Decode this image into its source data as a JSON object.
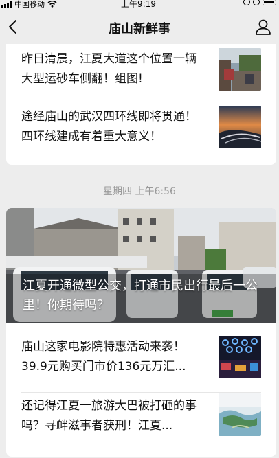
{
  "status_bar": {
    "carrier": "中国移动",
    "time": "上午9:19"
  },
  "nav": {
    "title": "庙山新鲜事"
  },
  "top_articles": [
    {
      "title": "昨日清晨，江夏大道这个位置一辆大型运砂车侧翻！组图!"
    },
    {
      "title": "途经庙山的武汉四环线即将贯通！四环线建成有着重大意义！"
    }
  ],
  "date_label": "星期四 上午6:56",
  "hero": {
    "title": "江夏开通微型公交，打通市民出行最后一公里！你期待吗？"
  },
  "bottom_articles": [
    {
      "title": "庙山这家电影院特惠活动来袭！39.9元购买门市价136元万汇..."
    },
    {
      "title": "还记得江夏一旅游大巴被打砸的事吗？寻衅滋事者获刑！江夏..."
    }
  ]
}
